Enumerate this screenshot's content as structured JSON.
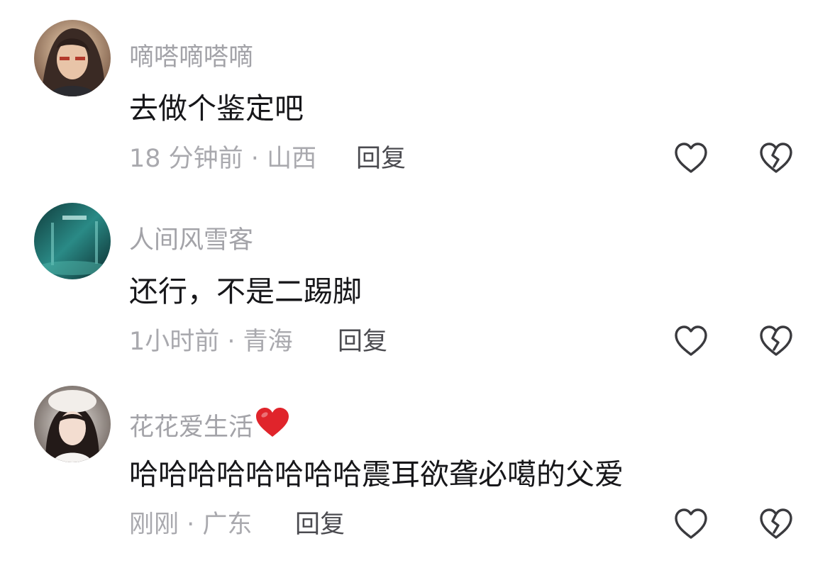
{
  "comments": [
    {
      "username": "嘀嗒嘀嗒嘀",
      "text": "去做个鉴定吧",
      "time": "18 分钟前",
      "location": "山西",
      "reply_label": "回复"
    },
    {
      "username": "人间风雪客",
      "text": "还行，不是二踢脚",
      "time": "1小时前",
      "location": "青海",
      "reply_label": "回复"
    },
    {
      "username": "花花爱生活",
      "username_emoji": "heart-emoji",
      "text": "哈哈哈哈哈哈哈哈震耳欲聋必噶的父爱",
      "time": "刚刚",
      "location": "广东",
      "reply_label": "回复"
    }
  ],
  "separator": " · ",
  "icons": {
    "like": "heart-outline-icon",
    "dislike": "broken-heart-icon"
  },
  "colors": {
    "username": "#a3a3a8",
    "text": "#17171a",
    "meta": "#a9a9ae",
    "reply": "#4b4b50",
    "icon": "#3a3a3e",
    "emoji_heart": "#e0242b"
  }
}
